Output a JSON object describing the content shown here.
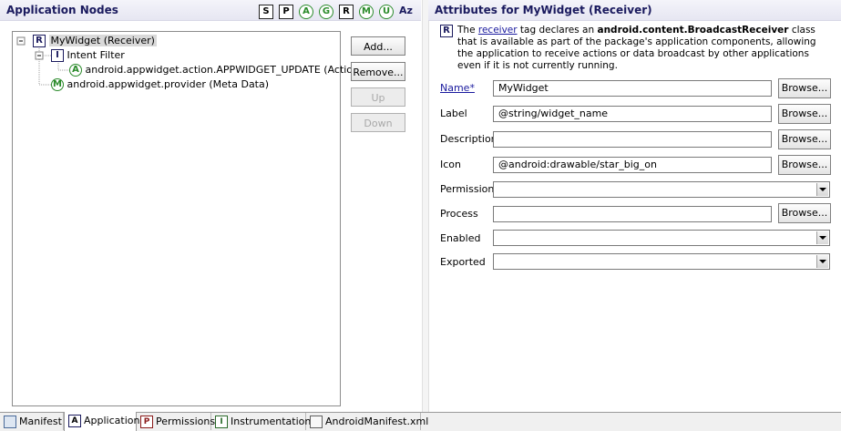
{
  "left_panel": {
    "title": "Application Nodes",
    "filters": [
      "S",
      "P",
      "A",
      "G",
      "R",
      "M",
      "U",
      "Az"
    ]
  },
  "tree": {
    "nodes": [
      {
        "icon": "R",
        "label": "MyWidget (Receiver)"
      },
      {
        "icon": "I",
        "label": "Intent Filter"
      },
      {
        "icon": "A",
        "label": "android.appwidget.action.APPWIDGET_UPDATE (Action)"
      },
      {
        "icon": "M",
        "label": "android.appwidget.provider (Meta Data)"
      }
    ]
  },
  "buttons": {
    "add": "Add...",
    "remove": "Remove...",
    "up": "Up",
    "down": "Down"
  },
  "right_panel": {
    "title": "Attributes for MyWidget (Receiver)",
    "desc_icon": "R",
    "desc_pre": "The ",
    "desc_link": "receiver",
    "desc_mid": " tag declares an ",
    "desc_bold": "android.content.BroadcastReceiver",
    "desc_post": " class that is available as part of the package's application components, allowing the application to receive actions or data broadcast by other applications even if it is not currently running."
  },
  "attributes": {
    "name_label": "Name*",
    "name_value": "MyWidget",
    "label_label": "Label",
    "label_value": "@string/widget_name",
    "description_label": "Description",
    "description_value": "",
    "icon_label": "Icon",
    "icon_value": "@android:drawable/star_big_on",
    "permission_label": "Permission",
    "permission_value": "",
    "process_label": "Process",
    "process_value": "",
    "enabled_label": "Enabled",
    "enabled_value": "",
    "exported_label": "Exported",
    "exported_value": "",
    "browse_label": "Browse..."
  },
  "tabs": [
    {
      "icon": "manifest-icon",
      "label": "Manifest"
    },
    {
      "icon": "A",
      "label": "Application"
    },
    {
      "icon": "P",
      "label": "Permissions"
    },
    {
      "icon": "I",
      "label": "Instrumentation"
    },
    {
      "icon": "xml-file-icon",
      "label": "AndroidManifest.xml"
    }
  ],
  "colors": {
    "title_text": "#1a1a5e",
    "link": "#1a1a9e",
    "green_icon": "#2a8a2a",
    "selected_bg": "#d9d9d9"
  }
}
